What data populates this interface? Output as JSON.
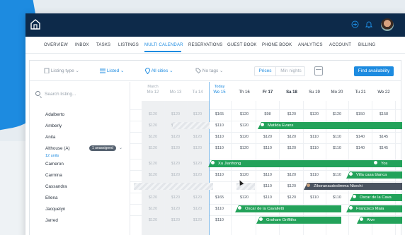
{
  "nav": {
    "items": [
      "OVERVIEW",
      "INBOX",
      "TASKS",
      "LISTINGS",
      "MULTI CALENDAR",
      "RESERVATIONS",
      "GUEST BOOK",
      "PHONE BOOK",
      "ANALYTICS",
      "ACCOUNT",
      "BILLING"
    ],
    "active": "MULTI CALENDAR"
  },
  "toolbar": {
    "listing_type": "Listing type",
    "listed": "Listed",
    "all_cities": "All cities",
    "no_tags": "No tags",
    "prices": "Prices",
    "min_nights": "Min nights",
    "find": "Find availability"
  },
  "search": {
    "placeholder": "Search listing..."
  },
  "month": "March",
  "today": "Today",
  "days": [
    {
      "label": "Mo 12",
      "type": "past"
    },
    {
      "label": "Mo 13",
      "type": "past"
    },
    {
      "label": "Tu 14",
      "type": "past"
    },
    {
      "label": "We 15",
      "type": "today"
    },
    {
      "label": "Th 16",
      "type": "normal"
    },
    {
      "label": "Fr 17",
      "type": "bold"
    },
    {
      "label": "Sa 18",
      "type": "bold"
    },
    {
      "label": "Su 19",
      "type": "normal"
    },
    {
      "label": "Mo 20",
      "type": "normal"
    },
    {
      "label": "Tu 21",
      "type": "normal"
    },
    {
      "label": "We 22",
      "type": "normal"
    }
  ],
  "listings": [
    {
      "name": "Adalberto",
      "prices": [
        "$120",
        "$120",
        "$120",
        "$165",
        "$120",
        "$98",
        "$120",
        "$120",
        "$120",
        "$150",
        "$158"
      ]
    },
    {
      "name": "Amberly",
      "prices": [
        "$120",
        "$120",
        "$120",
        "$110",
        "$120",
        "",
        "",
        "",
        "",
        "",
        ""
      ]
    },
    {
      "name": "Anita",
      "prices": [
        "$120",
        "$120",
        "$120",
        "$110",
        "$120",
        "$120",
        "$120",
        "$110",
        "$110",
        "$140",
        "$145"
      ]
    },
    {
      "name": "Althouse (A)",
      "badge": "1 unassigned",
      "units": "12 units",
      "prices": [
        "$120",
        "$120",
        "$120",
        "$110",
        "$120",
        "$110",
        "$120",
        "$110",
        "$110",
        "$140",
        "$145"
      ]
    },
    {
      "name": "Cameron",
      "prices": [
        "$120",
        "$120",
        "$120",
        "$110",
        "",
        "",
        "",
        "",
        "",
        "",
        ""
      ]
    },
    {
      "name": "Carmina",
      "prices": [
        "$120",
        "$120",
        "$120",
        "$110",
        "$120",
        "$110",
        "$120",
        "$110",
        "$110",
        "",
        ""
      ]
    },
    {
      "name": "Cassandra",
      "prices": [
        "",
        "",
        "",
        "",
        "$120",
        "$110",
        "$120",
        "$110",
        "",
        "",
        ""
      ]
    },
    {
      "name": "Ellena",
      "prices": [
        "$120",
        "$120",
        "$120",
        "$165",
        "$120",
        "$110",
        "$120",
        "$110",
        "$110",
        "",
        ""
      ]
    },
    {
      "name": "Jacquelyn",
      "prices": [
        "$120",
        "$120",
        "$120",
        "$110",
        "",
        "",
        "",
        "",
        "",
        "",
        ""
      ]
    },
    {
      "name": "Jarred",
      "prices": [
        "$120",
        "$120",
        "$120",
        "$110",
        "",
        "",
        "",
        "",
        "",
        "",
        ""
      ]
    }
  ],
  "reservations": [
    {
      "guest": "Matilda Evans"
    },
    {
      "guest": "Xu Jianhong"
    },
    {
      "guest": "Villa casa blanca"
    },
    {
      "guest": "Zikoranaudodimma Nkechi"
    },
    {
      "guest": "Oscar de la Cava"
    },
    {
      "guest": "Oscar de la Cavalletti"
    },
    {
      "guest": "Francisco Maia"
    },
    {
      "guest": "Graham Griffiths"
    },
    {
      "guest": "Yos"
    },
    {
      "guest": "Alve"
    }
  ]
}
